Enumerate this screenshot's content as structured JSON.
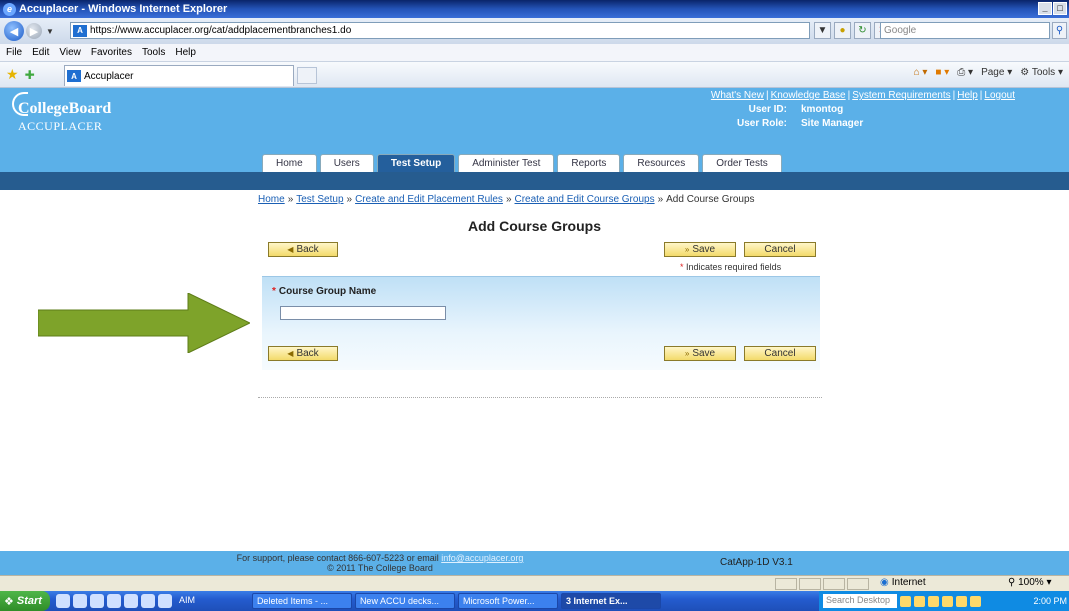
{
  "browser": {
    "title": "Accuplacer - Windows Internet Explorer",
    "url": "https://www.accuplacer.org/cat/addplacementbranches1.do",
    "search_placeholder": "Google",
    "menu": [
      "File",
      "Edit",
      "View",
      "Favorites",
      "Tools",
      "Help"
    ],
    "tab_label": "Accuplacer",
    "command_bar": [
      "Page",
      "Tools"
    ],
    "status_zone": "Internet",
    "zoom": "100%",
    "window_buttons": [
      "_",
      "□"
    ]
  },
  "header": {
    "logo_brand": "CollegeBoard",
    "logo_product": "ACCUPLACER",
    "top_links": [
      "What's New",
      "Knowledge Base",
      "System Requirements",
      "Help",
      "Logout"
    ],
    "user_id_label": "User ID:",
    "user_id": "kmontog",
    "user_role_label": "User Role:",
    "user_role": "Site Manager",
    "nav_tabs": [
      "Home",
      "Users",
      "Test Setup",
      "Administer Test",
      "Reports",
      "Resources",
      "Order Tests"
    ],
    "active_tab": "Test Setup"
  },
  "breadcrumb": {
    "links": [
      "Home",
      "Test Setup",
      "Create and Edit Placement Rules",
      "Create and Edit Course Groups"
    ],
    "separator": "»",
    "current": "Add Course Groups"
  },
  "page": {
    "title": "Add Course Groups",
    "back_label": "Back",
    "save_label": "Save",
    "cancel_label": "Cancel",
    "required_note": "Indicates required fields",
    "required_star": "*",
    "field_label": "Course Group Name",
    "field_value": ""
  },
  "footer": {
    "support_text": "For support, please contact 866-607-5223 or email",
    "support_email": "info@accuplacer.org",
    "copyright": "© 2011 The College Board",
    "version": "CatApp-1D  V3.1"
  },
  "taskbar": {
    "start": "Start",
    "tasks": [
      "AIM",
      "Deleted Items - ...",
      "New ACCU decks...",
      "Microsoft Power...",
      "3 Internet Ex..."
    ],
    "active_task": "3 Internet Ex...",
    "search_desktop": "Search Desktop",
    "clock": "2:00 PM"
  },
  "colors": {
    "header_blue": "#5bb0e8",
    "nav_dark": "#265c8f",
    "button_yellow": "#f3da6a",
    "arrow_green": "#7ea32a"
  }
}
